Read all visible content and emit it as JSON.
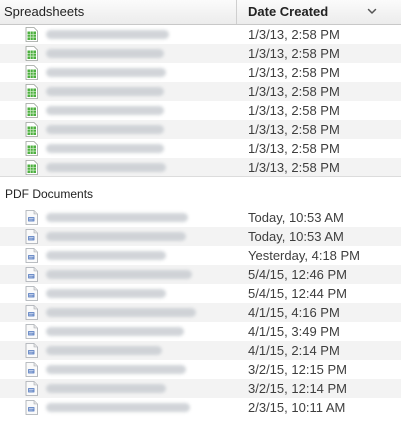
{
  "header": {
    "name_label": "Spreadsheets",
    "date_label": "Date Created",
    "sort_icon": "chevron-down-icon"
  },
  "spreadsheets": {
    "icon": "spreadsheet-icon",
    "rows": [
      {
        "date": "1/3/13, 2:58 PM"
      },
      {
        "date": "1/3/13, 2:58 PM"
      },
      {
        "date": "1/3/13, 2:58 PM"
      },
      {
        "date": "1/3/13, 2:58 PM"
      },
      {
        "date": "1/3/13, 2:58 PM"
      },
      {
        "date": "1/3/13, 2:58 PM"
      },
      {
        "date": "1/3/13, 2:58 PM"
      },
      {
        "date": "1/3/13, 2:58 PM"
      }
    ]
  },
  "pdf_documents": {
    "title": "PDF Documents",
    "icon": "pdf-document-icon",
    "rows": [
      {
        "date": "Today, 10:53 AM"
      },
      {
        "date": "Today, 10:53 AM"
      },
      {
        "date": "Yesterday, 4:18 PM"
      },
      {
        "date": "5/4/15, 12:46 PM"
      },
      {
        "date": "5/4/15, 12:44 PM"
      },
      {
        "date": "4/1/15, 4:16 PM"
      },
      {
        "date": "4/1/15, 3:49 PM"
      },
      {
        "date": "4/1/15, 2:14 PM"
      },
      {
        "date": "3/2/15, 12:15 PM"
      },
      {
        "date": "3/2/15, 12:14 PM"
      },
      {
        "date": "2/3/15, 10:11 AM"
      }
    ]
  },
  "colors": {
    "spreadsheet_green": "#3d9b3a",
    "pdf_blue": "#5a7fc0",
    "alt_row": "#f3f3f3"
  }
}
